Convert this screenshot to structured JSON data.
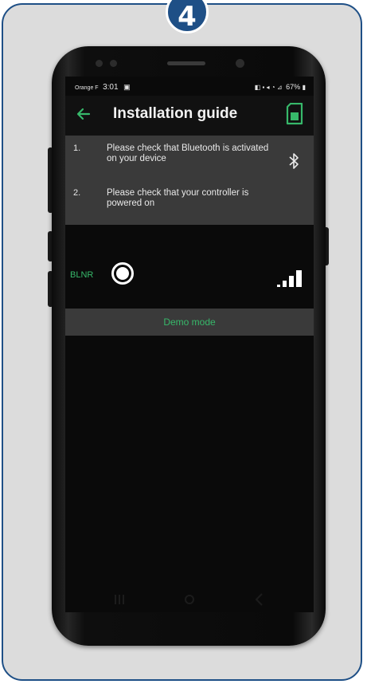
{
  "step_badge": "4",
  "statusbar": {
    "carrier": "Orange F",
    "time": "3:01",
    "battery": "67%"
  },
  "appbar": {
    "title": "Installation guide"
  },
  "guide": {
    "items": [
      {
        "number": "1.",
        "text": "Please check that Bluetooth is activated on your device"
      },
      {
        "number": "2.",
        "text": "Please check that your controller is powered on"
      }
    ]
  },
  "devices": [
    {
      "name": "BLNR",
      "selected": true
    }
  ],
  "demo_button": {
    "label": "Demo mode"
  },
  "colors": {
    "accent_green": "#37b86a",
    "frame_blue": "#1e4f86",
    "screen_bg": "#0a0a0a",
    "panel_bg": "#3a3a3a"
  },
  "icons": {
    "back": "arrow-left-icon",
    "sim": "sim-card-icon",
    "bluetooth": "bluetooth-icon",
    "signal": "signal-strength-icon"
  }
}
